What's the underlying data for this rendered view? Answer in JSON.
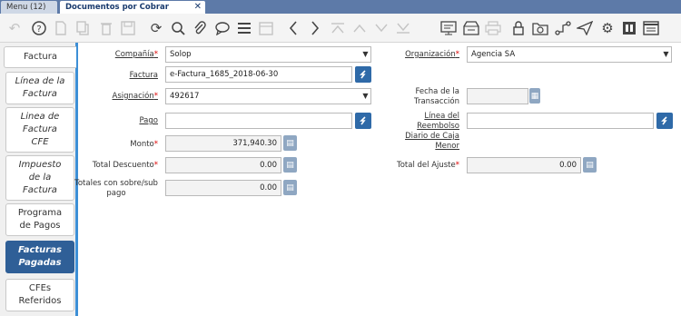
{
  "tabs": {
    "menu": "Menu (12)",
    "active": "Documentos por Cobrar",
    "close": "✕"
  },
  "toolbar": {
    "icons": [
      "undo-icon",
      "help-icon",
      "new-icon",
      "copy-icon",
      "delete-icon",
      "save-icon",
      "refresh-icon",
      "find-icon",
      "attachment-icon",
      "chat-icon",
      "grid-toggle-icon",
      "calendar-icon",
      "previous-icon",
      "next-icon",
      "first-icon",
      "up-icon",
      "down-icon",
      "last-icon",
      "report-icon",
      "archive-icon",
      "print-icon",
      "lock-icon",
      "zoom-across-icon",
      "workflow-icon",
      "send-icon",
      "settings-icon",
      "product-info-icon",
      "info-window-icon"
    ]
  },
  "vertical_tabs": [
    {
      "label": "Factura"
    },
    {
      "label": "Línea de la Factura"
    },
    {
      "label": "Linea de Factura CFE"
    },
    {
      "label": "Impuesto de la Factura"
    },
    {
      "label": "Programa de Pagos"
    },
    {
      "label": "Facturas Pagadas"
    },
    {
      "label": "CFEs Referidos"
    }
  ],
  "form": {
    "compania": {
      "label": "Compañía",
      "value": "Solop"
    },
    "organizacion": {
      "label": "Organización",
      "value": "Agencia SA"
    },
    "factura": {
      "label": "Factura",
      "value": "e-Factura_1685_2018-06-30"
    },
    "asignacion": {
      "label": "Asignación",
      "value": "492617"
    },
    "fecha_transaccion": {
      "label_1": "Fecha de la",
      "label_2": "Transacción",
      "value": ""
    },
    "pago": {
      "label": "Pago",
      "value": ""
    },
    "linea_reembolso": {
      "label_1": "Línea del Reembolso",
      "label_2": "Diario de Caja Menor",
      "value": ""
    },
    "monto": {
      "label": "Monto",
      "value": "371,940.30"
    },
    "total_descuento": {
      "label": "Total Descuento",
      "value": "0.00"
    },
    "total_ajuste": {
      "label": "Total del Ajuste",
      "value": "0.00"
    },
    "totales_sobre_sub": {
      "label_1": "Totales con sobre/sub",
      "label_2": "pago",
      "value": "0.00"
    }
  },
  "colors": {
    "accent": "#2f6aa8",
    "tabbar": "#5d7aa8",
    "required": "#dd0000"
  }
}
